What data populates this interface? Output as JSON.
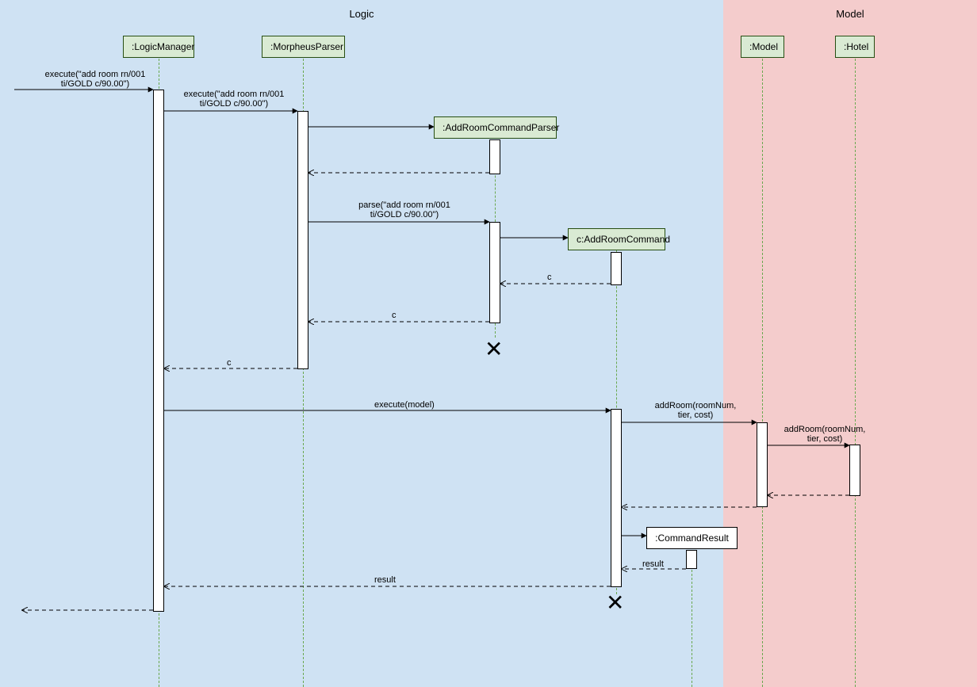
{
  "regions": {
    "logic": "Logic",
    "model": "Model"
  },
  "participants": {
    "logicManager": ":LogicManager",
    "morpheusParser": ":MorpheusParser",
    "addRoomCommandParser": ":AddRoomCommandParser",
    "addRoomCommand": "c:AddRoomCommand",
    "commandResult": ":CommandResult",
    "model": ":Model",
    "hotel": ":Hotel"
  },
  "messages": {
    "m1_line1": "execute(\"add room rn/001",
    "m1_line2": "ti/GOLD c/90.00\")",
    "m2_line1": "execute(\"add room rn/001",
    "m2_line2": "ti/GOLD c/90.00\")",
    "m3_line1": "parse(\"add room rn/001",
    "m3_line2": "ti/GOLD c/90.00\")",
    "m4": "c",
    "m5": "c",
    "m6": "c",
    "m7": "execute(model)",
    "m8_line1": "addRoom(roomNum,",
    "m8_line2": "tier, cost)",
    "m9_line1": "addRoom(roomNum,",
    "m9_line2": "tier, cost)",
    "m10": "result",
    "m11": "result"
  },
  "chart_data": {
    "type": "sequence-diagram",
    "regions": [
      {
        "name": "Logic",
        "participants": [
          ":LogicManager",
          ":MorpheusParser",
          ":AddRoomCommandParser",
          "c:AddRoomCommand",
          ":CommandResult"
        ]
      },
      {
        "name": "Model",
        "participants": [
          ":Model",
          ":Hotel"
        ]
      }
    ],
    "messages": [
      {
        "from": "actor",
        "to": ":LogicManager",
        "label": "execute(\"add room rn/001 ti/GOLD c/90.00\")",
        "type": "sync"
      },
      {
        "from": ":LogicManager",
        "to": ":MorpheusParser",
        "label": "execute(\"add room rn/001 ti/GOLD c/90.00\")",
        "type": "sync"
      },
      {
        "from": ":MorpheusParser",
        "to": ":AddRoomCommandParser",
        "label": "",
        "type": "create"
      },
      {
        "from": ":AddRoomCommandParser",
        "to": ":MorpheusParser",
        "label": "",
        "type": "return"
      },
      {
        "from": ":MorpheusParser",
        "to": ":AddRoomCommandParser",
        "label": "parse(\"add room rn/001 ti/GOLD c/90.00\")",
        "type": "sync"
      },
      {
        "from": ":AddRoomCommandParser",
        "to": "c:AddRoomCommand",
        "label": "",
        "type": "create"
      },
      {
        "from": "c:AddRoomCommand",
        "to": ":AddRoomCommandParser",
        "label": "c",
        "type": "return"
      },
      {
        "from": ":AddRoomCommandParser",
        "to": ":MorpheusParser",
        "label": "c",
        "type": "return"
      },
      {
        "from": ":AddRoomCommandParser",
        "to": "destroy",
        "label": "",
        "type": "destroy"
      },
      {
        "from": ":MorpheusParser",
        "to": ":LogicManager",
        "label": "c",
        "type": "return"
      },
      {
        "from": ":LogicManager",
        "to": "c:AddRoomCommand",
        "label": "execute(model)",
        "type": "sync"
      },
      {
        "from": "c:AddRoomCommand",
        "to": ":Model",
        "label": "addRoom(roomNum, tier, cost)",
        "type": "sync"
      },
      {
        "from": ":Model",
        "to": ":Hotel",
        "label": "addRoom(roomNum, tier, cost)",
        "type": "sync"
      },
      {
        "from": ":Hotel",
        "to": ":Model",
        "label": "",
        "type": "return"
      },
      {
        "from": ":Model",
        "to": "c:AddRoomCommand",
        "label": "",
        "type": "return"
      },
      {
        "from": "c:AddRoomCommand",
        "to": ":CommandResult",
        "label": "",
        "type": "create"
      },
      {
        "from": ":CommandResult",
        "to": "c:AddRoomCommand",
        "label": "result",
        "type": "return"
      },
      {
        "from": "c:AddRoomCommand",
        "to": ":LogicManager",
        "label": "result",
        "type": "return"
      },
      {
        "from": "c:AddRoomCommand",
        "to": "destroy",
        "label": "",
        "type": "destroy"
      },
      {
        "from": ":LogicManager",
        "to": "actor",
        "label": "",
        "type": "return"
      }
    ]
  }
}
